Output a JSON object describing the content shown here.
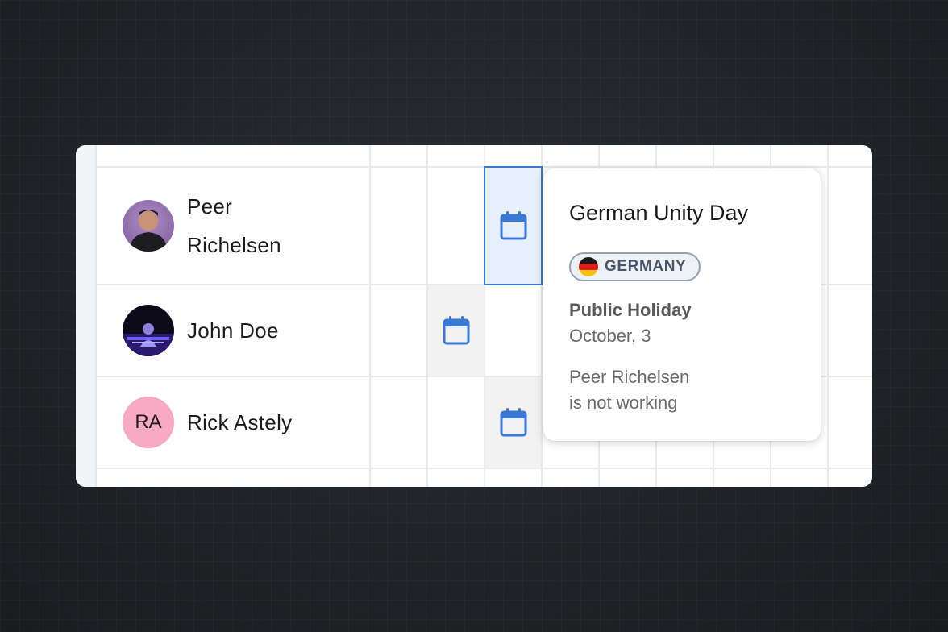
{
  "colors": {
    "accent": "#3a78d6",
    "selected_cell_bg": "#e8effc",
    "holiday_cell_bg": "#f2f2f3",
    "avatar_rick": "#f8a9c4"
  },
  "employees": [
    {
      "name_line1": "Peer",
      "name_line2": "Richelsen",
      "avatar": "photo"
    },
    {
      "name": "John Doe",
      "avatar": "photo"
    },
    {
      "name": "Rick Astely",
      "avatar_initials": "RA"
    }
  ],
  "calendar_cells": [
    {
      "row": 0,
      "icon": "calendar-icon",
      "state": "selected"
    },
    {
      "row": 1,
      "icon": "calendar-icon",
      "state": "holiday"
    },
    {
      "row": 2,
      "icon": "calendar-icon",
      "state": "holiday"
    }
  ],
  "popover": {
    "title": "German Unity Day",
    "country": "GERMANY",
    "flag_icon": "germany-flag-icon",
    "type": "Public Holiday",
    "date": "October, 3",
    "note_line1": "Peer Richelsen",
    "note_line2": "is not working"
  }
}
